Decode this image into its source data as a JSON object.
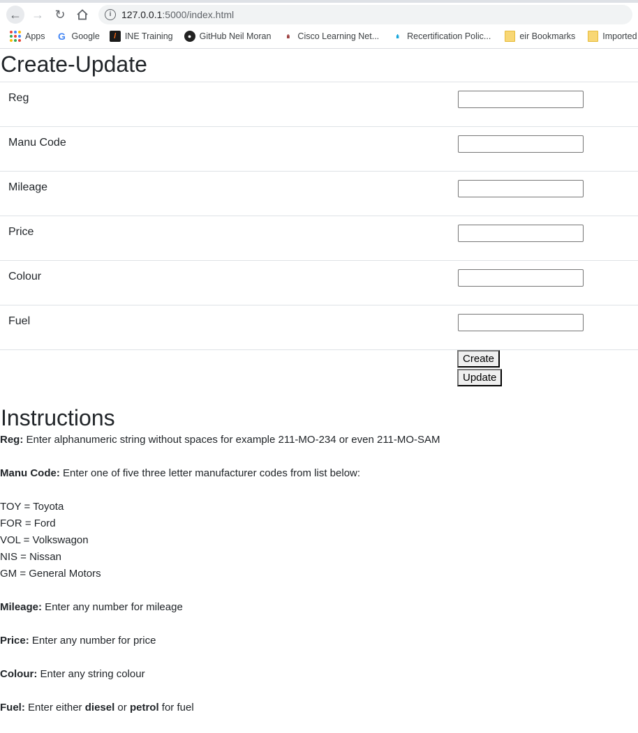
{
  "browser": {
    "url_host": "127.0.0.1",
    "url_path": ":5000/index.html",
    "bookmarks": [
      {
        "label": "Apps",
        "icon": "apps-icon"
      },
      {
        "label": "Google",
        "icon": "google-icon"
      },
      {
        "label": "INE Training",
        "icon": "ine-icon"
      },
      {
        "label": "GitHub Neil Moran",
        "icon": "github-icon"
      },
      {
        "label": "Cisco Learning Net...",
        "icon": "cisco-icon"
      },
      {
        "label": "Recertification Polic...",
        "icon": "cisco-icon"
      },
      {
        "label": "eir Bookmarks",
        "icon": "folder-icon"
      },
      {
        "label": "Imported",
        "icon": "folder-icon"
      }
    ]
  },
  "form": {
    "title": "Create-Update",
    "fields": [
      {
        "label": "Reg",
        "value": ""
      },
      {
        "label": "Manu Code",
        "value": ""
      },
      {
        "label": "Mileage",
        "value": ""
      },
      {
        "label": "Price",
        "value": ""
      },
      {
        "label": "Colour",
        "value": ""
      },
      {
        "label": "Fuel",
        "value": ""
      }
    ],
    "create_label": "Create",
    "update_label": "Update"
  },
  "instructions": {
    "title": "Instructions",
    "reg_label": "Reg:",
    "reg_text": " Enter alphanumeric string without spaces for example 211-MO-234 or even 211-MO-SAM",
    "manu_label": "Manu Code:",
    "manu_text": " Enter one of five three letter manufacturer codes from list below:",
    "codes": [
      "TOY = Toyota",
      "FOR = Ford",
      "VOL = Volkswagon",
      "NIS = Nissan",
      "GM = General Motors"
    ],
    "mileage_label": "Mileage:",
    "mileage_text": " Enter any number for mileage",
    "price_label": "Price:",
    "price_text": " Enter any number for price",
    "colour_label": "Colour:",
    "colour_text": " Enter any string colour",
    "fuel_label": "Fuel:",
    "fuel_text_1": " Enter either ",
    "fuel_opt_1": "diesel",
    "fuel_text_2": " or ",
    "fuel_opt_2": "petrol",
    "fuel_text_3": " for fuel"
  },
  "colors": {
    "text": "#212529",
    "border": "#dee2e6"
  }
}
